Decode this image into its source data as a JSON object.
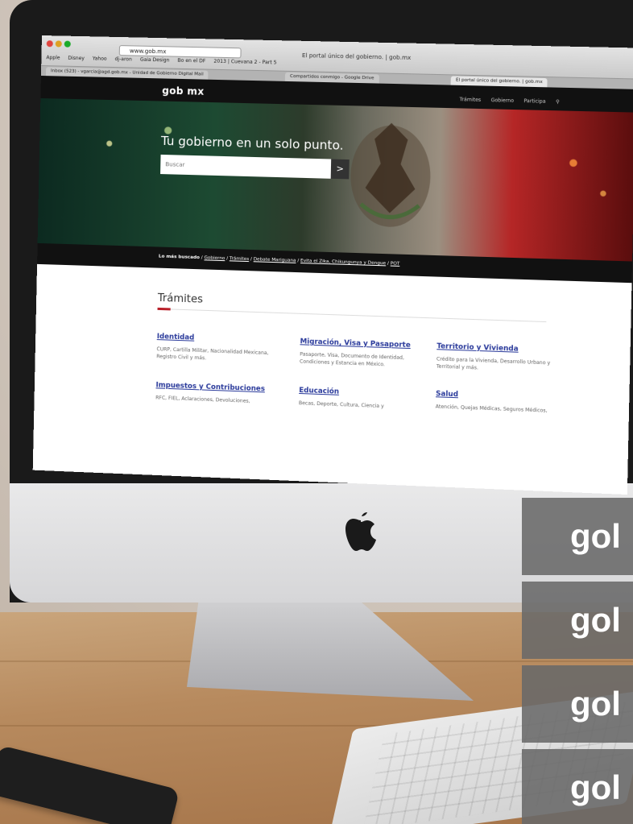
{
  "browser": {
    "url": "www.gob.mx",
    "window_title": "El portal único del gobierno. | gob.mx",
    "bookmarks": [
      "Apple",
      "Disney",
      "Yahoo",
      "dj-aron",
      "Gaia Design",
      "Bo en el DF",
      "2013 | Cuevana 2 - Part 5"
    ],
    "tabs": [
      "Inbox (523) - vgarcia@agd.gob.mx - Unidad de Gobierno Digital Mail",
      "Compartidos conmigo - Google Drive",
      "El portal único del gobierno. | gob.mx"
    ]
  },
  "site": {
    "brand": "gob mx",
    "nav": [
      "Trámites",
      "Gobierno",
      "Participa"
    ],
    "hero_title": "Tu gobierno en un solo punto.",
    "search_placeholder": "Buscar",
    "search_button": ">",
    "most_searched_label": "Lo más buscado",
    "most_searched_links": [
      "Gobierno",
      "Trámites",
      "Debate Mariguana",
      "Evita el Zika, Chikungunya y Dengue",
      "POT"
    ],
    "section_title": "Trámites",
    "items": [
      {
        "title": "Identidad",
        "desc": "CURP, Cartilla Militar, Nacionalidad Mexicana, Registro Civil y más."
      },
      {
        "title": "Migración, Visa y Pasaporte",
        "desc": "Pasaporte, Visa, Documento de Identidad, Condiciones y Estancia en México."
      },
      {
        "title": "Territorio y Vivienda",
        "desc": "Crédito para la Vivienda, Desarrollo Urbano y Territorial y más."
      },
      {
        "title": "Impuestos y Contribuciones",
        "desc": "RFC, FIEL, Aclaraciones, Devoluciones,"
      },
      {
        "title": "Educación",
        "desc": "Becas, Deporte, Cultura, Ciencia y"
      },
      {
        "title": "Salud",
        "desc": "Atención, Quejas Médicas, Seguros Médicos,"
      }
    ]
  },
  "overlay": {
    "stripe_labels": [
      "gol",
      "gol",
      "gol",
      "gol"
    ]
  },
  "colors": {
    "link_blue": "#2a3a9b",
    "accent_red": "#b9202a",
    "navbar": "#111111"
  },
  "icons": [
    "apple-logo-icon",
    "chevron-right-icon",
    "search-icon"
  ]
}
